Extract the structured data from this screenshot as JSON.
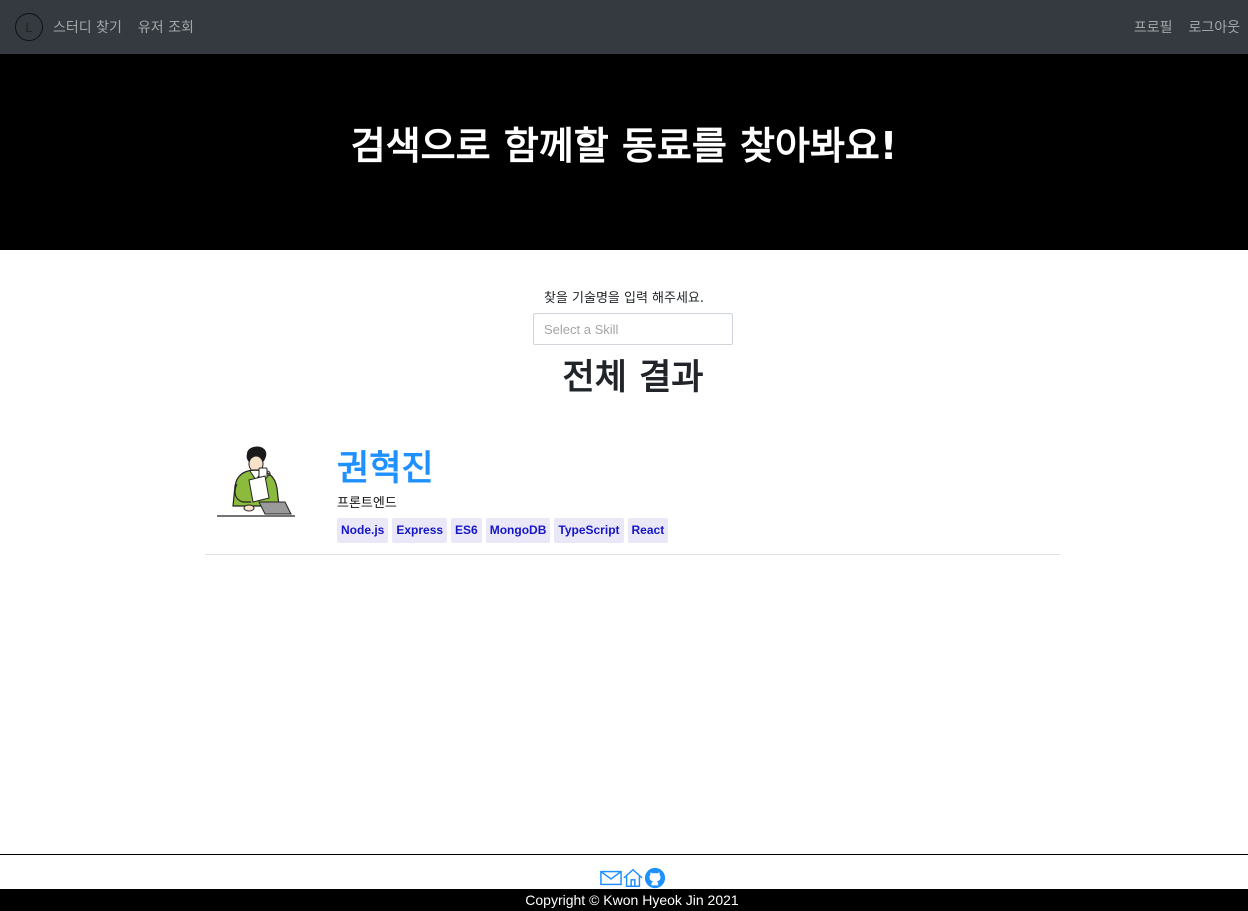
{
  "navbar": {
    "logo_letter": "L",
    "links_left": [
      "스터디 찾기",
      "유저 조회"
    ],
    "links_right": [
      "프로필",
      "로그아웃"
    ],
    "background": "#343a40"
  },
  "hero": {
    "title": "검색으로 함께할 동료를 찾아봐요!"
  },
  "search": {
    "label": "찾을 기술명을 입력 해주세요.",
    "placeholder": "Select a Skill"
  },
  "results": {
    "title": "전체 결과",
    "items": [
      {
        "name": "권혁진",
        "role": "프론트엔드",
        "avatar_icon": "person-with-laptop-illustration",
        "tags": [
          "Node.js",
          "Express",
          "ES6",
          "MongoDB",
          "TypeScript",
          "React"
        ]
      }
    ]
  },
  "footer": {
    "icons": [
      "mail-icon",
      "home-icon",
      "github-icon"
    ],
    "copyright": "Copyright © Kwon Hyeok Jin 2021"
  },
  "colors": {
    "accent": "#1e90ff",
    "tag_bg": "#eae8f7",
    "tag_text": "#1515c8"
  }
}
